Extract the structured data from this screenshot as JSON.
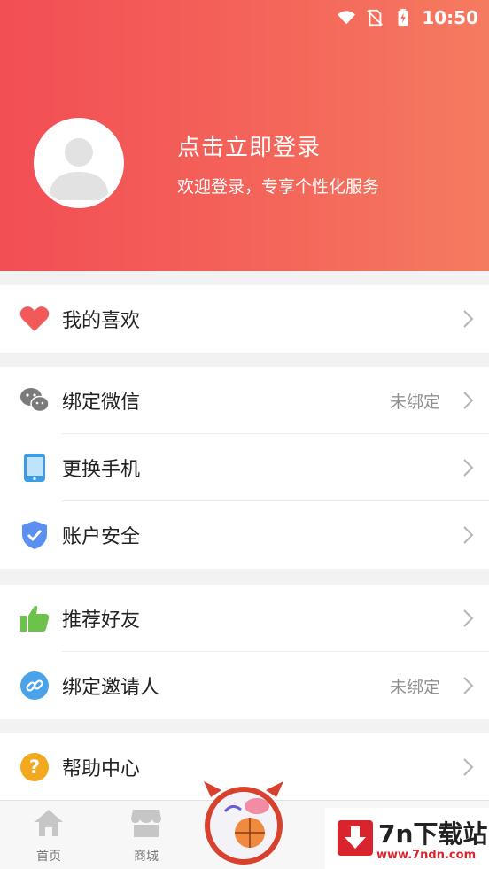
{
  "status_bar": {
    "time": "10:50"
  },
  "profile": {
    "login_title": "点击立即登录",
    "login_subtitle": "欢迎登录，专享个性化服务"
  },
  "menu": {
    "favorites": {
      "label": "我的喜欢",
      "icon": "heart-icon",
      "color": "#f25a5a"
    },
    "bind_wechat": {
      "label": "绑定微信",
      "status": "未绑定",
      "icon": "wechat-icon",
      "color": "#7a7a7a"
    },
    "change_phone": {
      "label": "更换手机",
      "icon": "phone-icon",
      "color": "#3a9de6"
    },
    "account_security": {
      "label": "账户安全",
      "icon": "shield-icon",
      "color": "#5b8ff0"
    },
    "recommend_friend": {
      "label": "推荐好友",
      "icon": "thumbs-up-icon",
      "color": "#6cc24a"
    },
    "bind_inviter": {
      "label": "绑定邀请人",
      "status": "未绑定",
      "icon": "link-icon",
      "color": "#4aa3e8"
    },
    "help_center": {
      "label": "帮助中心",
      "icon": "help-icon",
      "color": "#f2a81f"
    }
  },
  "bottom_nav": {
    "home": {
      "label": "首页",
      "icon": "home-icon"
    },
    "mall": {
      "label": "商城",
      "icon": "store-icon"
    }
  },
  "watermark": {
    "title": "7n下载站",
    "url": "www.7ndn.com"
  },
  "colors": {
    "header_start": "#f24e55",
    "header_end": "#f57b60",
    "watermark_red": "#d9232d"
  }
}
